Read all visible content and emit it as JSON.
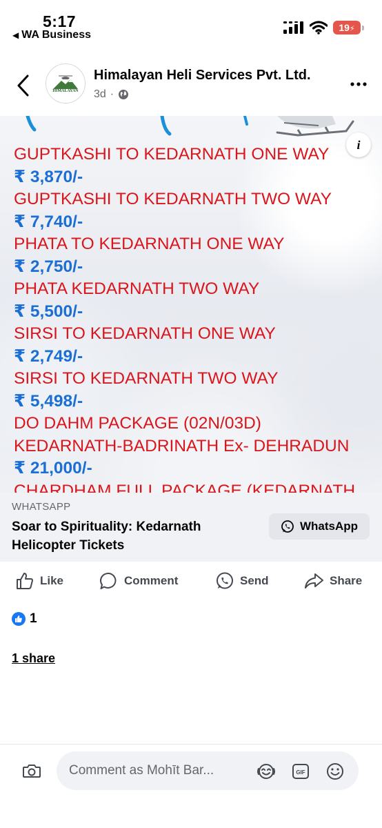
{
  "status_bar": {
    "time": "5:17",
    "back_app": "WA Business",
    "battery": "19"
  },
  "post": {
    "page_name": "Himalayan Heli Services Pvt. Ltd.",
    "time_ago": "3d",
    "avatar_text": "HIMALAYAN"
  },
  "image_lines": [
    {
      "text": "GUPTKASHI TO KEDARNATH ONE WAY",
      "kind": "dest"
    },
    {
      "text": "₹ 3,870/-",
      "kind": "price"
    },
    {
      "text": "GUPTKASHI TO KEDARNATH TWO WAY",
      "kind": "dest"
    },
    {
      "text": "₹ 7,740/-",
      "kind": "price"
    },
    {
      "text": "PHATA TO KEDARNATH ONE WAY",
      "kind": "dest"
    },
    {
      "text": "₹ 2,750/-",
      "kind": "price"
    },
    {
      "text": "PHATA KEDARNATH TWO WAY",
      "kind": "dest"
    },
    {
      "text": "₹ 5,500/-",
      "kind": "price"
    },
    {
      "text": "SIRSI TO KEDARNATH ONE WAY",
      "kind": "dest"
    },
    {
      "text": "₹ 2,749/-",
      "kind": "price"
    },
    {
      "text": "SIRSI TO KEDARNATH TWO WAY",
      "kind": "dest"
    },
    {
      "text": "₹ 5,498/-",
      "kind": "price"
    },
    {
      "text": "DO DAHM PACKAGE (02N/03D)",
      "kind": "dest"
    },
    {
      "text": "KEDARNATH-BADRINATH Ex- DEHRADUN",
      "kind": "dest"
    },
    {
      "text": "₹ 21,000/-",
      "kind": "price"
    },
    {
      "text": "CHARDHAM FULL PACKAGE (KEDARNATH",
      "kind": "dest"
    }
  ],
  "link_preview": {
    "source": "WHATSAPP",
    "title": "Soar to Spirituality: Kedarnath Helicopter Tickets",
    "button_label": "WhatsApp"
  },
  "actions": {
    "like": "Like",
    "comment": "Comment",
    "send": "Send",
    "share": "Share"
  },
  "reactions": {
    "count": "1"
  },
  "shares": "1 share",
  "comment_bar": {
    "placeholder": "Comment as Mohīt Bar..."
  },
  "colors": {
    "destination_text": "#d9161c",
    "price_text": "#1b6fd4",
    "brand_blue": "#1877f2",
    "battery": "#e4564b"
  }
}
